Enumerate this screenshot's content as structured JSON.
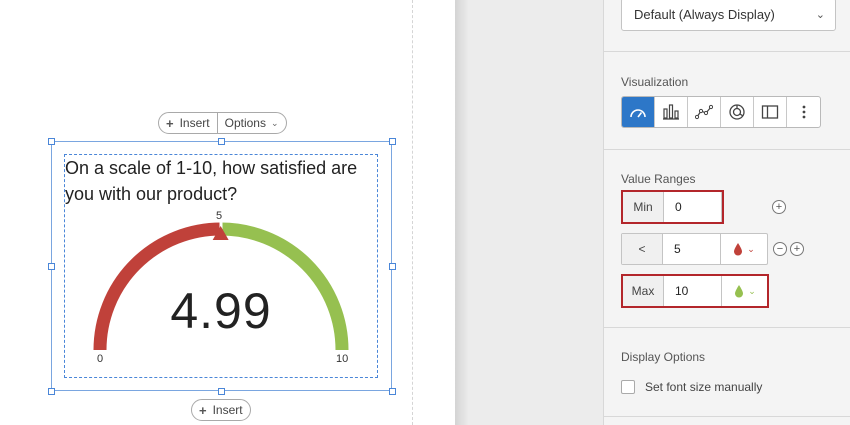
{
  "canvas": {
    "top_toolbar": {
      "insert_label": "Insert",
      "options_label": "Options"
    },
    "bottom_toolbar": {
      "insert_label": "Insert"
    },
    "question_text": "On a scale of 1-10, how satisfied are you with our product?",
    "gauge": {
      "min_label": "0",
      "mid_label": "5",
      "max_label": "10",
      "min": 0,
      "max": 10,
      "threshold": 5,
      "value": 4.99,
      "value_text": "4.99",
      "low_color": "#c0413a",
      "high_color": "#96c050",
      "marker_color": "#c0413a"
    }
  },
  "panel": {
    "display_dropdown": {
      "selected": "Default (Always Display)"
    },
    "visualization": {
      "title": "Visualization",
      "buttons": [
        {
          "name": "gauge",
          "active": true
        },
        {
          "name": "bar-chart",
          "active": false
        },
        {
          "name": "line-chart",
          "active": false
        },
        {
          "name": "breakdown",
          "active": false
        },
        {
          "name": "table",
          "active": false
        },
        {
          "name": "more",
          "active": false
        }
      ]
    },
    "value_ranges": {
      "title": "Value Ranges",
      "min": {
        "label": "Min",
        "value": "0"
      },
      "mid": {
        "label": "<",
        "value": "5",
        "color": "#c0413a"
      },
      "max": {
        "label": "Max",
        "value": "10",
        "color": "#96c050"
      }
    },
    "display_options": {
      "title": "Display Options",
      "font_size_checkbox_label": "Set font size manually",
      "font_size_checked": false
    },
    "highlight_color": "#b3262b",
    "active_color": "#2d77c8"
  }
}
